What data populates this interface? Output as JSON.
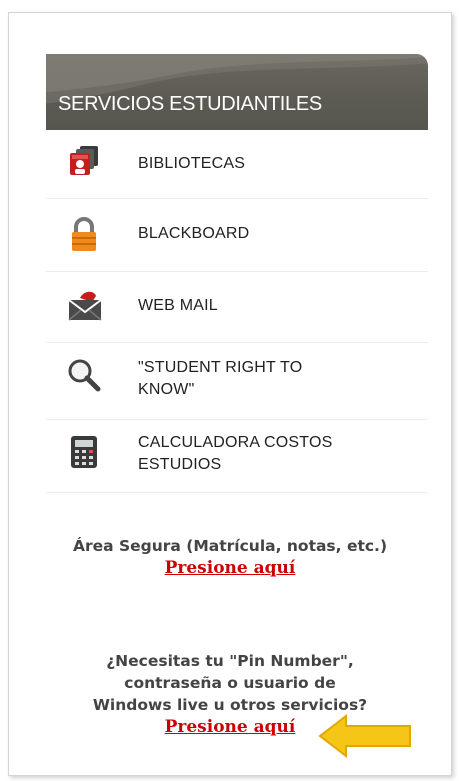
{
  "header": {
    "title": "SERVICIOS ESTUDIANTILES"
  },
  "menu": {
    "items": [
      {
        "label": "BIBLIOTECAS",
        "icon": "library-icon"
      },
      {
        "label": "BLACKBOARD",
        "icon": "lock-icon"
      },
      {
        "label": "WEB MAIL",
        "icon": "mail-icon"
      },
      {
        "label": "\"STUDENT RIGHT TO KNOW\"",
        "icon": "magnifier-icon"
      },
      {
        "label": "CALCULADORA COSTOS ESTUDIOS",
        "icon": "calculator-icon"
      }
    ]
  },
  "secure_area": {
    "text": "Área Segura (Matrícula, notas, etc.)",
    "link": "Presione aquí"
  },
  "pin_help": {
    "line1": "¿Necesitas tu \"Pin Number\",",
    "line2": "contraseña o usuario de",
    "line3": "Windows live u otros servicios?",
    "link": "Presione aquí"
  },
  "colors": {
    "header_bg": "#5f5e56",
    "link": "#cc0000",
    "arrow": "#f5c518"
  }
}
